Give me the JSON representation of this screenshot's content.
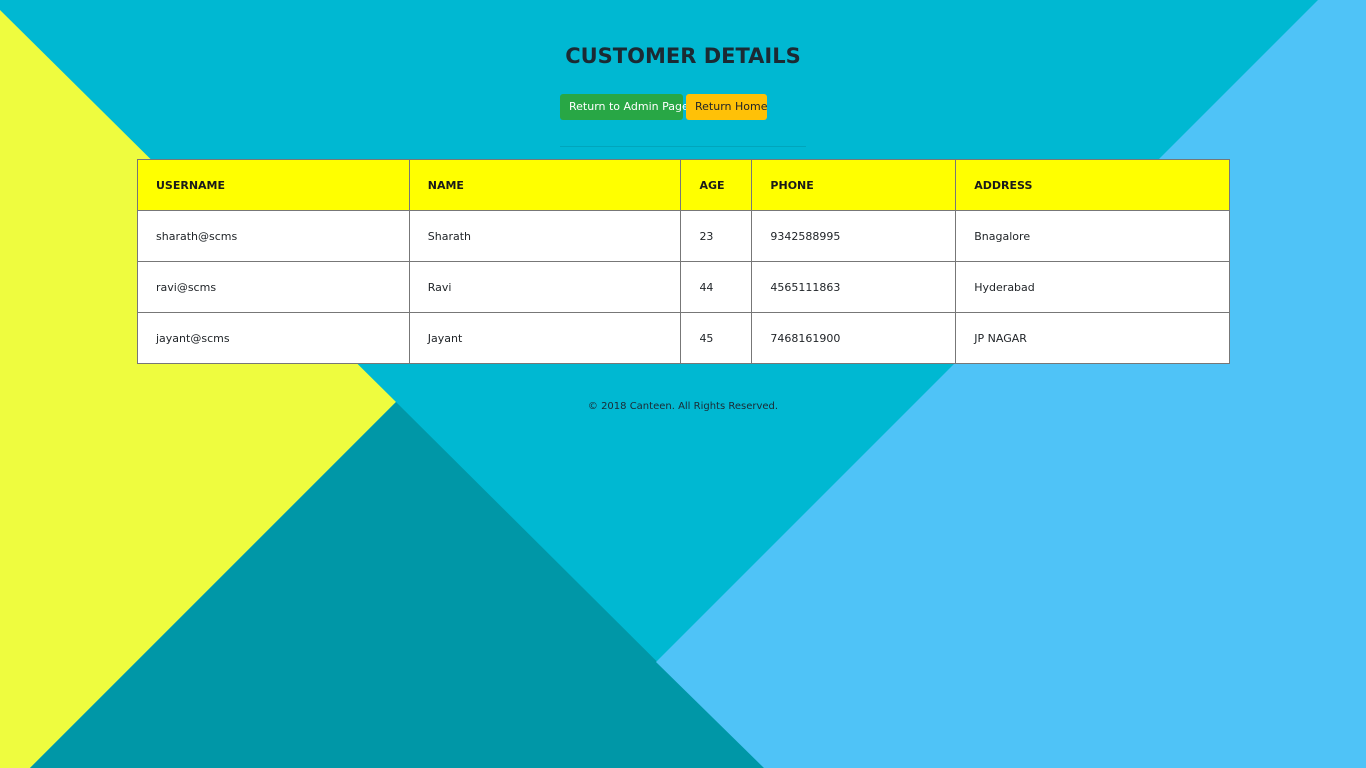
{
  "page": {
    "title": "CUSTOMER DETAILS",
    "footer": "© 2018 Canteen. All Rights Reserved."
  },
  "actions": {
    "admin_label": "Return to Admin Page",
    "home_label": "Return Home"
  },
  "table": {
    "headers": {
      "username": "USERNAME",
      "name": "NAME",
      "age": "AGE",
      "phone": "PHONE",
      "address": "ADDRESS"
    },
    "rows": [
      {
        "username": "sharath@scms",
        "name": "Sharath",
        "age": "23",
        "phone": "9342588995",
        "address": "Bnagalore"
      },
      {
        "username": "ravi@scms",
        "name": "Ravi",
        "age": "44",
        "phone": "4565111863",
        "address": "Hyderabad"
      },
      {
        "username": "jayant@scms",
        "name": "Jayant",
        "age": "45",
        "phone": "7468161900",
        "address": "JP NAGAR"
      }
    ]
  },
  "colors": {
    "background_cyan": "#00b8d2",
    "background_yellow": "#eefc3f",
    "background_teal": "#0097a7",
    "background_lightblue": "#4fc3f7",
    "header_yellow": "#ffff00",
    "admin_button_green": "#28a745",
    "home_button_amber": "#ffc107"
  }
}
